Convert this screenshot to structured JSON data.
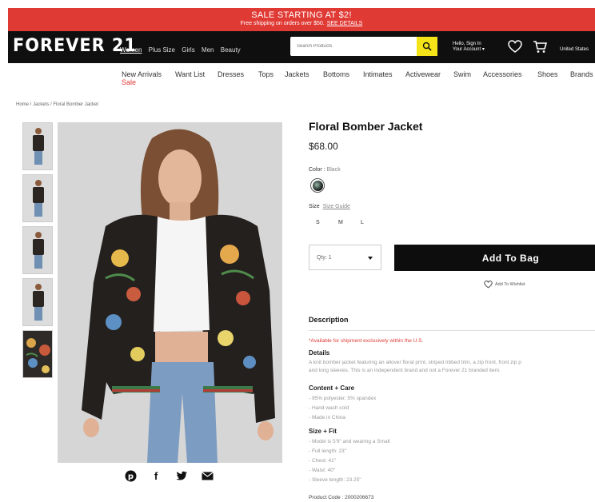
{
  "promo": {
    "headline": "SALE STARTING AT $2!",
    "subline": "Free shipping on orders over $50.",
    "link": "SEE DETAILS"
  },
  "header": {
    "logo": "FOREVER 21",
    "top_nav": [
      "Women",
      "Plus Size",
      "Girls",
      "Men",
      "Beauty"
    ],
    "active_nav": "Women",
    "search_placeholder": "Search Products",
    "account_line1": "Hello, Sign In",
    "account_line2": "Your Account",
    "country": "United States"
  },
  "category_nav": {
    "items": [
      "New Arrivals",
      "Want List",
      "Dresses",
      "Tops",
      "Jackets",
      "Bottoms",
      "Intimates",
      "Activewear",
      "Swim",
      "Accessories",
      "Shoes",
      "Brands"
    ],
    "sale_label": "Sale"
  },
  "breadcrumb": "Home / Jackets / Floral Bomber Jacket",
  "product": {
    "title": "Floral Bomber Jacket",
    "price": "$68.00",
    "color_label": "Color",
    "color_value": "Black",
    "size_label": "Size",
    "size_guide": "Size Guide",
    "sizes": [
      "S",
      "M",
      "L"
    ],
    "qty_label": "Qty: 1",
    "add_to_bag": "Add To Bag",
    "wishlist": "Add To Wishlist"
  },
  "description": {
    "heading": "Description",
    "availability": "*Available for shipment exclusively within the U.S.",
    "details_heading": "Details",
    "details_lines": [
      "A knit bomber jacket featuring an allover floral print, striped ribbed trim, a zip front, front zip p",
      "and long sleeves. This is an independent brand and not a Forever 21 branded item."
    ],
    "content_heading": "Content + Care",
    "content_lines": [
      "- 95% polyester, 5% spandex",
      "- Hand wash cold",
      "- Made in China"
    ],
    "size_heading": "Size + Fit",
    "size_lines": [
      "- Model is 5'9\" and wearing a Small",
      "- Full length: 23\"",
      "- Chest: 41\"",
      "- Waist: 40\"",
      "- Sleeve length: 23.25\""
    ],
    "product_code": "Product Code : 2000206673"
  },
  "share": {
    "icons": [
      "pinterest-icon",
      "facebook-icon",
      "twitter-icon",
      "email-icon"
    ],
    "facebook_glyph": "f"
  },
  "colors": {
    "promo_red": "#e03a35",
    "header_black": "#0f0f0f",
    "search_yellow": "#f3e318",
    "sale_red": "#e03a35"
  }
}
